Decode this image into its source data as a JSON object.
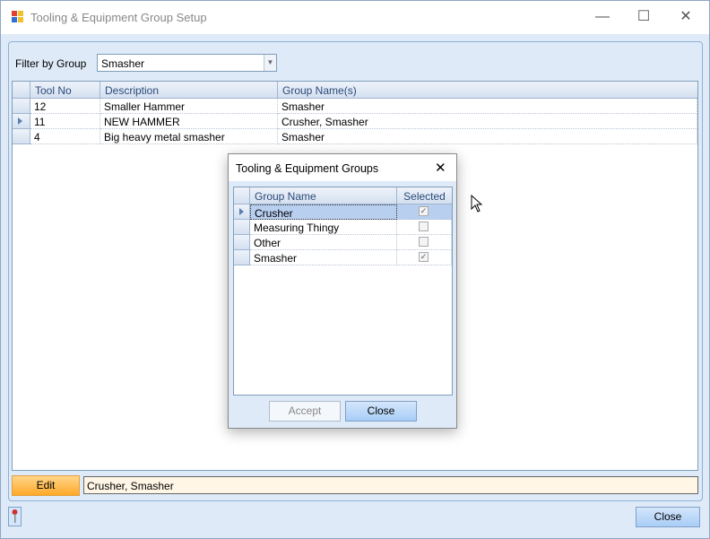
{
  "window": {
    "title": "Tooling & Equipment Group Setup",
    "minimize": "—",
    "maximize": "☐",
    "close": "✕"
  },
  "filter": {
    "label": "Filter by Group",
    "value": "Smasher"
  },
  "grid": {
    "columns": [
      "Tool No",
      "Description",
      "Group Name(s)"
    ],
    "rows": [
      {
        "tool_no": "12",
        "description": "Smaller Hammer",
        "groups": "Smasher",
        "current": false
      },
      {
        "tool_no": "11",
        "description": "NEW HAMMER",
        "groups": "Crusher, Smasher",
        "current": true
      },
      {
        "tool_no": "4",
        "description": "Big heavy metal smasher",
        "groups": "Smasher",
        "current": false
      }
    ]
  },
  "dialog": {
    "title": "Tooling & Equipment Groups",
    "close": "✕",
    "columns": [
      "Group Name",
      "Selected"
    ],
    "rows": [
      {
        "name": "Crusher",
        "selected": true
      },
      {
        "name": "Measuring Thingy",
        "selected": false
      },
      {
        "name": "Other",
        "selected": false
      },
      {
        "name": "Smasher",
        "selected": true
      }
    ],
    "accept_label": "Accept",
    "close_label": "Close"
  },
  "footer": {
    "edit_label": "Edit",
    "edit_value": "Crusher, Smasher",
    "close_label": "Close"
  }
}
